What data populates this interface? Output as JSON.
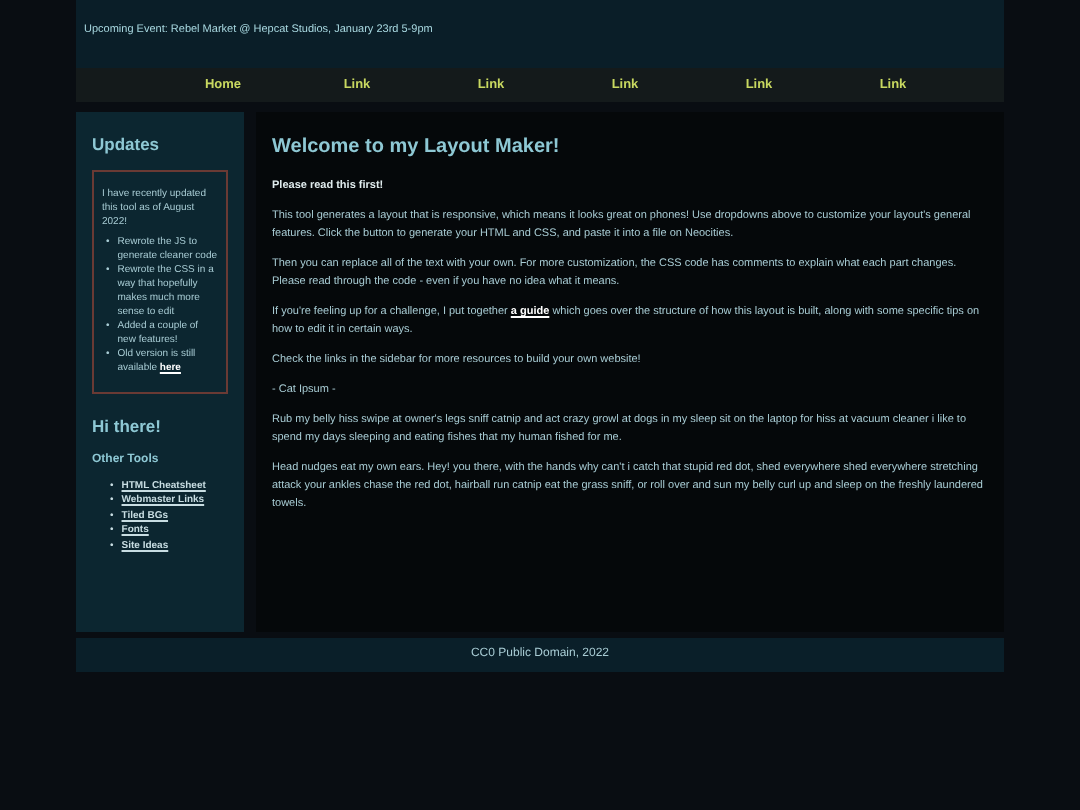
{
  "header": {
    "event": "Upcoming Event: Rebel Market @ Hepcat Studios, January 23rd 5-9pm"
  },
  "nav": [
    {
      "label": "Home"
    },
    {
      "label": "Link"
    },
    {
      "label": "Link"
    },
    {
      "label": "Link"
    },
    {
      "label": "Link"
    },
    {
      "label": "Link"
    }
  ],
  "sidebar": {
    "title": "Updates",
    "updates": {
      "intro": "I have recently updated this tool as of August 2022!",
      "bullet": "•",
      "items": [
        {
          "text": "Rewrote the JS to generate cleaner code"
        },
        {
          "text": "Rewrote the CSS in a way that hopefully makes much more sense to edit"
        },
        {
          "text": "Added a couple of new features!"
        },
        {
          "text": "Old version is still available",
          "link": "here"
        }
      ]
    },
    "greeting": "Hi there!",
    "tools_title": "Other Tools",
    "tools_bullet": "•",
    "tools": [
      "HTML Cheatsheet",
      "Webmaster Links",
      "Tiled BGs",
      "Fonts",
      "Site Ideas"
    ]
  },
  "main": {
    "title": "Welcome to my Layout Maker!",
    "paragraphs": [
      {
        "kind": "bold",
        "text": "Please read this first!"
      },
      {
        "kind": "plain",
        "text": "This tool generates a layout that is responsive, which means it looks great on phones! Use dropdowns above to customize your layout's general features. Click the button to generate your HTML and CSS, and paste it into a file on Neocities."
      },
      {
        "kind": "plain",
        "text": "Then you can replace all of the text with your own. For more customization, the CSS code has comments to explain what each part changes. Please read through the code - even if you have no idea what it means."
      },
      {
        "kind": "link",
        "before": "If you're feeling up for a challenge, I put together",
        "link": "a guide",
        "after": "which goes over the structure of how this layout is built, along with some specific tips on how to edit it in certain ways."
      },
      {
        "kind": "plain",
        "text": "Check the links in the sidebar for more resources to build your own website!"
      },
      {
        "kind": "plain",
        "text": "- Cat Ipsum -"
      },
      {
        "kind": "plain",
        "text": "Rub my belly hiss swipe at owner's legs sniff catnip and act crazy growl at dogs in my sleep sit on the laptop for hiss at vacuum cleaner i like to spend my days sleeping and eating fishes that my human fished for me."
      },
      {
        "kind": "plain",
        "text": "Head nudges eat my own ears. Hey! you there, with the hands why can't i catch that stupid red dot, shed everywhere shed everywhere stretching attack your ankles chase the red dot, hairball run catnip eat the grass sniff, or roll over and sun my belly curl up and sleep on the freshly laundered towels."
      }
    ]
  },
  "footer": {
    "text": "CC0 Public Domain, 2022"
  }
}
